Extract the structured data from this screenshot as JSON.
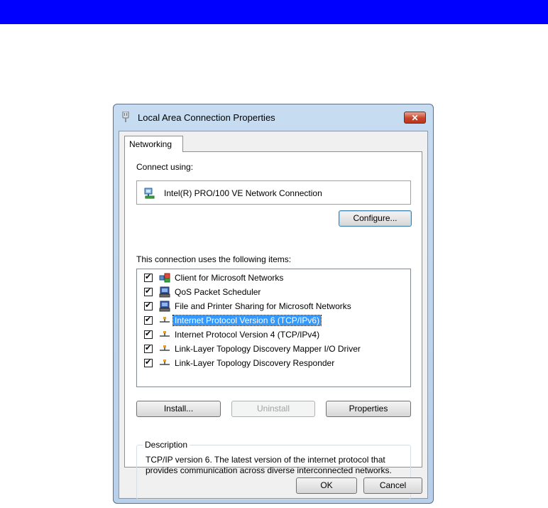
{
  "colors": {
    "top_bar": "#0000ff",
    "selection": "#3399ff",
    "window_frame": "#c7dcf1"
  },
  "window": {
    "title": "Local Area Connection Properties",
    "icon": "network-adapter-icon",
    "close_icon": "close-icon",
    "close_label": "✕"
  },
  "tabs": [
    {
      "label": "Networking",
      "selected": true
    }
  ],
  "connect_using": {
    "label": "Connect using:",
    "adapter_name": "Intel(R) PRO/100 VE Network Connection",
    "icon": "network-adapter-icon",
    "configure_label": "Configure..."
  },
  "items_section": {
    "label": "This connection uses the following items:",
    "items": [
      {
        "label": "Client for Microsoft Networks",
        "checked": true,
        "icon": "client-icon"
      },
      {
        "label": "QoS Packet Scheduler",
        "checked": true,
        "icon": "service-icon"
      },
      {
        "label": "File and Printer Sharing for Microsoft Networks",
        "checked": true,
        "icon": "service-icon"
      },
      {
        "label": "Internet Protocol Version 6 (TCP/IPv6)",
        "checked": true,
        "icon": "protocol-icon",
        "selected": true
      },
      {
        "label": "Internet Protocol Version 4 (TCP/IPv4)",
        "checked": true,
        "icon": "protocol-icon"
      },
      {
        "label": "Link-Layer Topology Discovery Mapper I/O Driver",
        "checked": true,
        "icon": "protocol-icon"
      },
      {
        "label": "Link-Layer Topology Discovery Responder",
        "checked": true,
        "icon": "protocol-icon"
      }
    ]
  },
  "buttons": {
    "install": "Install...",
    "uninstall": "Uninstall",
    "properties": "Properties",
    "ok": "OK",
    "cancel": "Cancel"
  },
  "description": {
    "title": "Description",
    "text": "TCP/IP version 6. The latest version of the internet protocol that provides communication across diverse interconnected networks."
  }
}
